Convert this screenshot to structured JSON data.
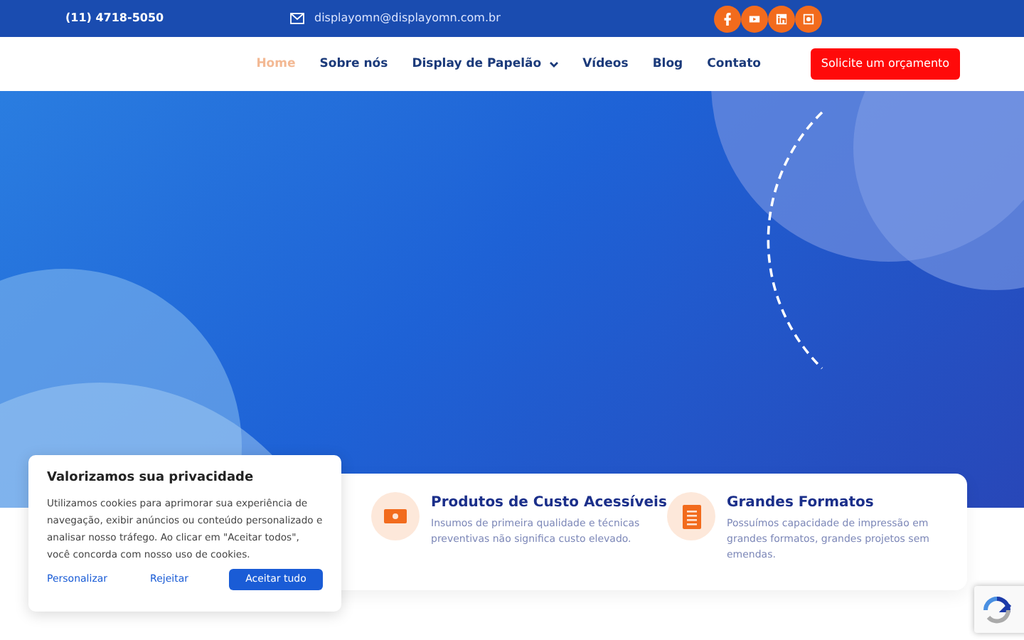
{
  "topbar": {
    "phone": "(11) 4718-5050",
    "email": "displayomn@displayomn.com.br"
  },
  "nav": {
    "items": [
      {
        "label": "Home",
        "selected": true,
        "dropdown": false
      },
      {
        "label": "Sobre nós",
        "selected": false,
        "dropdown": false
      },
      {
        "label": "Display de Papelão",
        "selected": false,
        "dropdown": true
      },
      {
        "label": "Vídeos",
        "selected": false,
        "dropdown": false
      },
      {
        "label": "Blog",
        "selected": false,
        "dropdown": false
      },
      {
        "label": "Contato",
        "selected": false,
        "dropdown": false
      }
    ],
    "cta": "Solicite um orçamento"
  },
  "features": [
    {
      "kind": "money",
      "title": "Produtos de Custo Acessíveis",
      "text": "Insumos de primeira qualidade e técnicas preventivas não significa custo elevado."
    },
    {
      "kind": "document",
      "title": "Grandes Formatos",
      "text": "Possuímos capacidade de impressão em grandes formatos, grandes projetos sem emendas."
    }
  ],
  "cookie_banner": {
    "title": "Valorizamos sua privacidade",
    "text": "Utilizamos cookies para aprimorar sua experiência de navegação, exibir anúncios ou conteúdo personalizado e analisar nosso tráfego. Ao clicar em \"Aceitar todos\", você concorda com nosso uso de cookies.",
    "buttons": [
      {
        "label": "Personalizar",
        "kind": "link"
      },
      {
        "label": "Rejeitar",
        "kind": "link"
      },
      {
        "label": "Aceitar tudo",
        "kind": "primary"
      }
    ]
  }
}
